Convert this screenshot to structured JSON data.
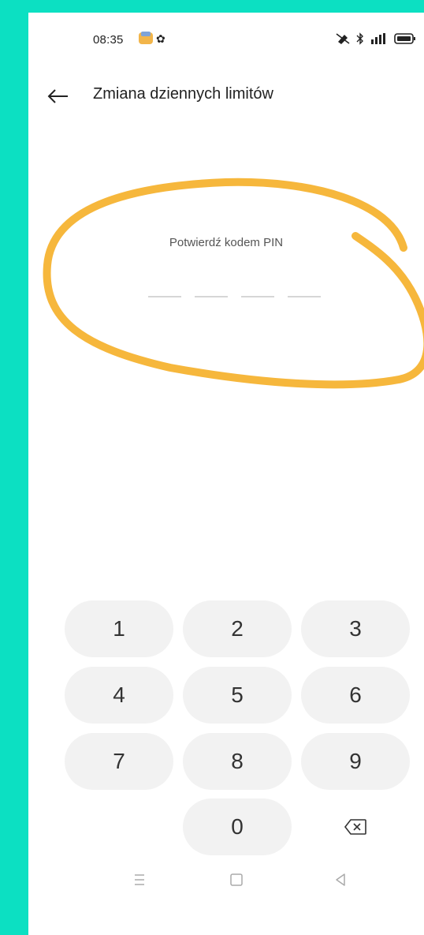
{
  "status_bar": {
    "time": "08:35",
    "icons": [
      "app-icon",
      "settings-icon",
      "vibrate-icon",
      "bluetooth-icon",
      "signal-icon",
      "battery-icon"
    ]
  },
  "header": {
    "title": "Zmiana dziennych limitów",
    "back_icon": "arrow-left-icon"
  },
  "pin": {
    "label": "Potwierdź kodem PIN",
    "length": 4,
    "entered": 0
  },
  "keypad": {
    "keys": [
      "1",
      "2",
      "3",
      "4",
      "5",
      "6",
      "7",
      "8",
      "9",
      "0"
    ],
    "delete_icon": "backspace-icon"
  },
  "nav_bar": {
    "icons": [
      "menu-icon",
      "home-icon",
      "back-triangle-icon"
    ]
  },
  "colors": {
    "background": "#0ce0c2",
    "highlight": "#f6b73c",
    "key_background": "#f2f2f2"
  }
}
